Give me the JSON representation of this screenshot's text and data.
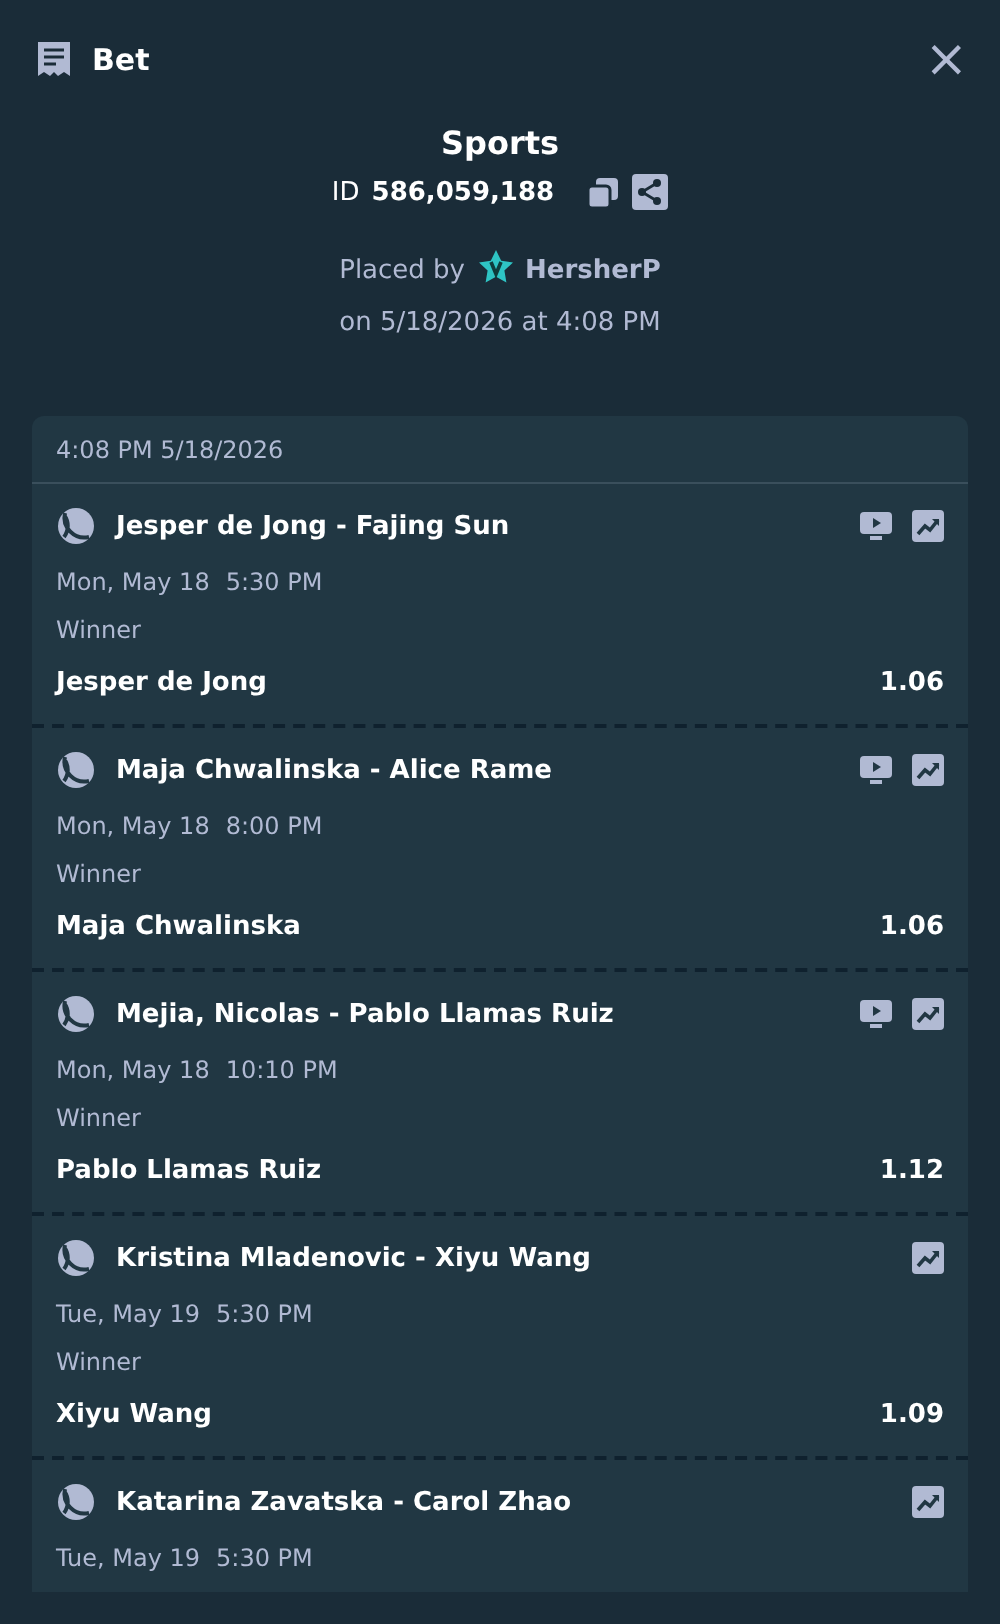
{
  "header": {
    "title": "Bet",
    "close": "×"
  },
  "summary": {
    "category": "Sports",
    "id_label": "ID",
    "id_value": "586,059,188",
    "placed_by": "Placed by",
    "user": "HersherP",
    "placed_on": "on 5/18/2026 at 4:08 PM"
  },
  "slip": {
    "timestamp": "4:08 PM 5/18/2026",
    "legs": [
      {
        "event": "Jesper de Jong - Fajing Sun",
        "stream": true,
        "date": "Mon, May 18",
        "time": "5:30 PM",
        "market": "Winner",
        "selection": "Jesper de Jong",
        "odds": "1.06"
      },
      {
        "event": "Maja Chwalinska - Alice Rame",
        "stream": true,
        "date": "Mon, May 18",
        "time": "8:00 PM",
        "market": "Winner",
        "selection": "Maja Chwalinska",
        "odds": "1.06"
      },
      {
        "event": "Mejia, Nicolas - Pablo Llamas Ruiz",
        "stream": true,
        "date": "Mon, May 18",
        "time": "10:10 PM",
        "market": "Winner",
        "selection": "Pablo Llamas Ruiz",
        "odds": "1.12"
      },
      {
        "event": "Kristina Mladenovic - Xiyu Wang",
        "stream": false,
        "date": "Tue, May 19",
        "time": "5:30 PM",
        "market": "Winner",
        "selection": "Xiyu Wang",
        "odds": "1.09"
      },
      {
        "event": "Katarina Zavatska - Carol Zhao",
        "stream": false,
        "date": "Tue, May 19",
        "time": "5:30 PM"
      }
    ]
  }
}
